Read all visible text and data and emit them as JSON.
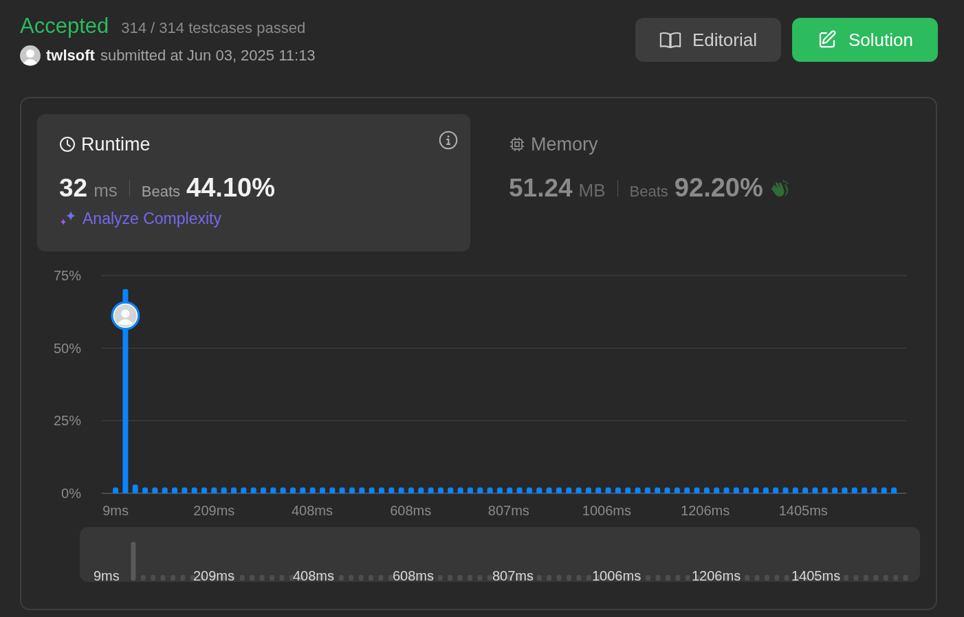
{
  "header": {
    "status": "Accepted",
    "tests": "314 / 314 testcases passed",
    "user": "twlsoft",
    "submitted": "submitted at Jun 03, 2025 11:13"
  },
  "buttons": [
    {
      "label": "Editorial",
      "kind": "secondary"
    },
    {
      "label": "Solution",
      "kind": "primary"
    }
  ],
  "metrics": [
    {
      "kind": "runtime",
      "title": "Runtime",
      "value": "32",
      "unit": "ms",
      "beats_label": "Beats",
      "beats": "44.10%",
      "selected": true,
      "link": "Analyze Complexity"
    },
    {
      "kind": "memory",
      "title": "Memory",
      "value": "51.24",
      "unit": "MB",
      "beats_label": "Beats",
      "beats": "92.20%",
      "selected": false
    }
  ],
  "chart": {
    "chart_data": {
      "type": "bar",
      "x": [
        9,
        29,
        49,
        69,
        89,
        109,
        129,
        149,
        169,
        189,
        209,
        229,
        249,
        269,
        289,
        309,
        329,
        349,
        369,
        389,
        409,
        429,
        449,
        469,
        489,
        509,
        529,
        549,
        569,
        589,
        609,
        629,
        649,
        669,
        689,
        709,
        729,
        749,
        769,
        789,
        809,
        829,
        849,
        869,
        889,
        909,
        929,
        949,
        969,
        989,
        1009,
        1029,
        1049,
        1069,
        1089,
        1109,
        1129,
        1149,
        1169,
        1189,
        1209,
        1229,
        1249,
        1269,
        1289,
        1309,
        1329,
        1349,
        1369,
        1389,
        1409,
        1429,
        1449,
        1469,
        1489,
        1509,
        1529,
        1549,
        1569,
        1589
      ],
      "values": [
        2,
        70.3,
        3,
        2,
        2,
        2,
        2,
        2,
        2,
        2,
        2,
        2,
        2,
        2,
        2,
        2,
        2,
        2,
        2,
        2,
        2,
        2,
        2,
        2,
        2,
        2,
        2,
        2,
        2,
        2,
        2,
        2,
        2,
        2,
        2,
        2,
        2,
        2,
        2,
        2,
        2,
        2,
        2,
        2,
        2,
        2,
        2,
        2,
        2,
        2,
        2,
        2,
        2,
        2,
        2,
        2,
        2,
        2,
        2,
        2,
        2,
        2,
        2,
        2,
        2,
        2,
        2,
        2,
        2,
        2,
        2,
        2,
        2,
        2,
        2,
        2,
        2,
        2,
        2,
        2
      ],
      "xlim": [
        -19,
        1614
      ],
      "ylim": [
        0,
        75
      ],
      "yticks": [
        {
          "value": 0,
          "label": "0%"
        },
        {
          "value": 25,
          "label": "25%"
        },
        {
          "value": 50,
          "label": "50%"
        },
        {
          "value": 75,
          "label": "75%"
        }
      ],
      "xticks": [
        {
          "value": 9,
          "label": "9ms"
        },
        {
          "value": 209,
          "label": "209ms"
        },
        {
          "value": 408,
          "label": "408ms"
        },
        {
          "value": 608,
          "label": "608ms"
        },
        {
          "value": 807,
          "label": "807ms"
        },
        {
          "value": 1006,
          "label": "1006ms"
        },
        {
          "value": 1206,
          "label": "1206ms"
        },
        {
          "value": 1405,
          "label": "1405ms"
        }
      ]
    }
  },
  "overview": {
    "labels": [
      "9ms",
      "209ms",
      "408ms",
      "608ms",
      "807ms",
      "1006ms",
      "1206ms",
      "1405ms"
    ]
  }
}
